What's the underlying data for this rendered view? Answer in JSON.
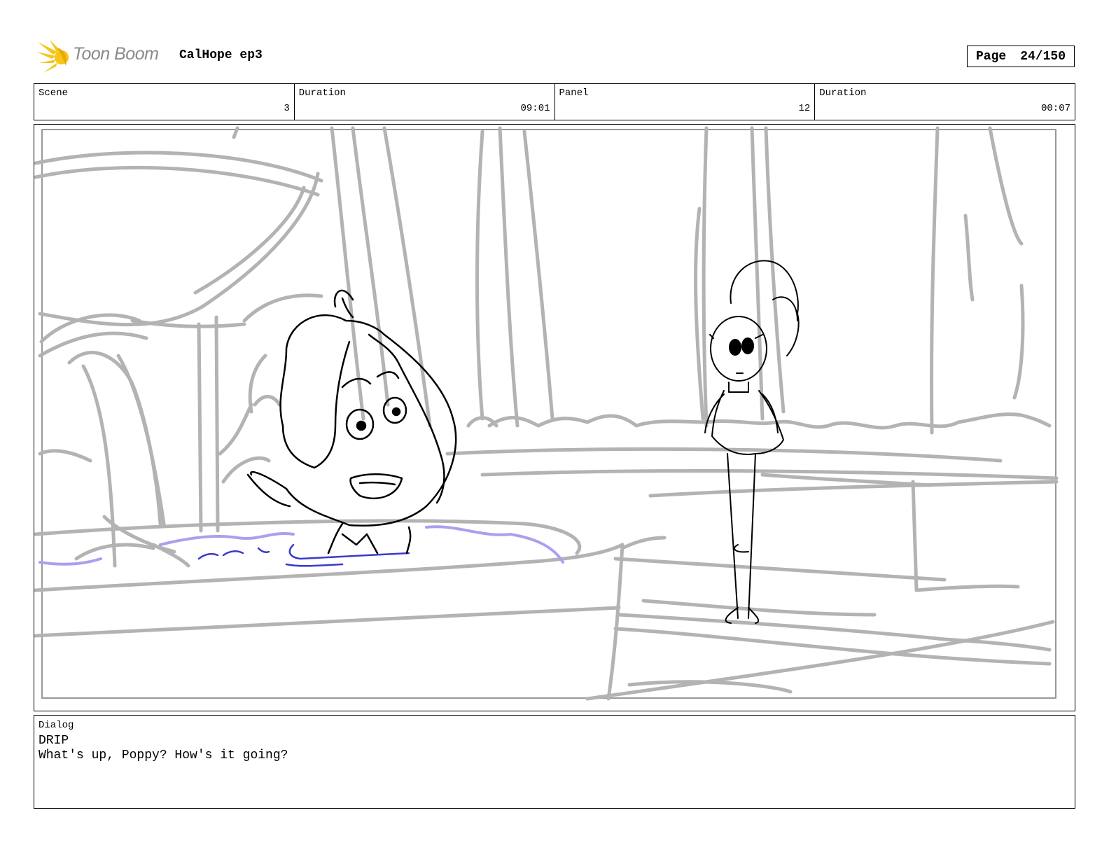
{
  "header": {
    "brand": "Toon Boom",
    "project_title": "CalHope ep3",
    "page_label": "Page",
    "page_number": "24/150"
  },
  "info": {
    "scene_label": "Scene",
    "scene_value": "3",
    "scene_duration_label": "Duration",
    "scene_duration_value": "09:01",
    "panel_label": "Panel",
    "panel_value": "12",
    "panel_duration_label": "Duration",
    "panel_duration_value": "00:07"
  },
  "dialog": {
    "label": "Dialog",
    "character": "DRIP",
    "line": "What's up, Poppy? How's it going?"
  },
  "colors": {
    "sketch_gray": "#b3b3b3",
    "ink": "#000000",
    "water_blue": "#3a3acc",
    "water_lavender": "#a9a0ee",
    "logo_yellow": "#f5c518"
  }
}
